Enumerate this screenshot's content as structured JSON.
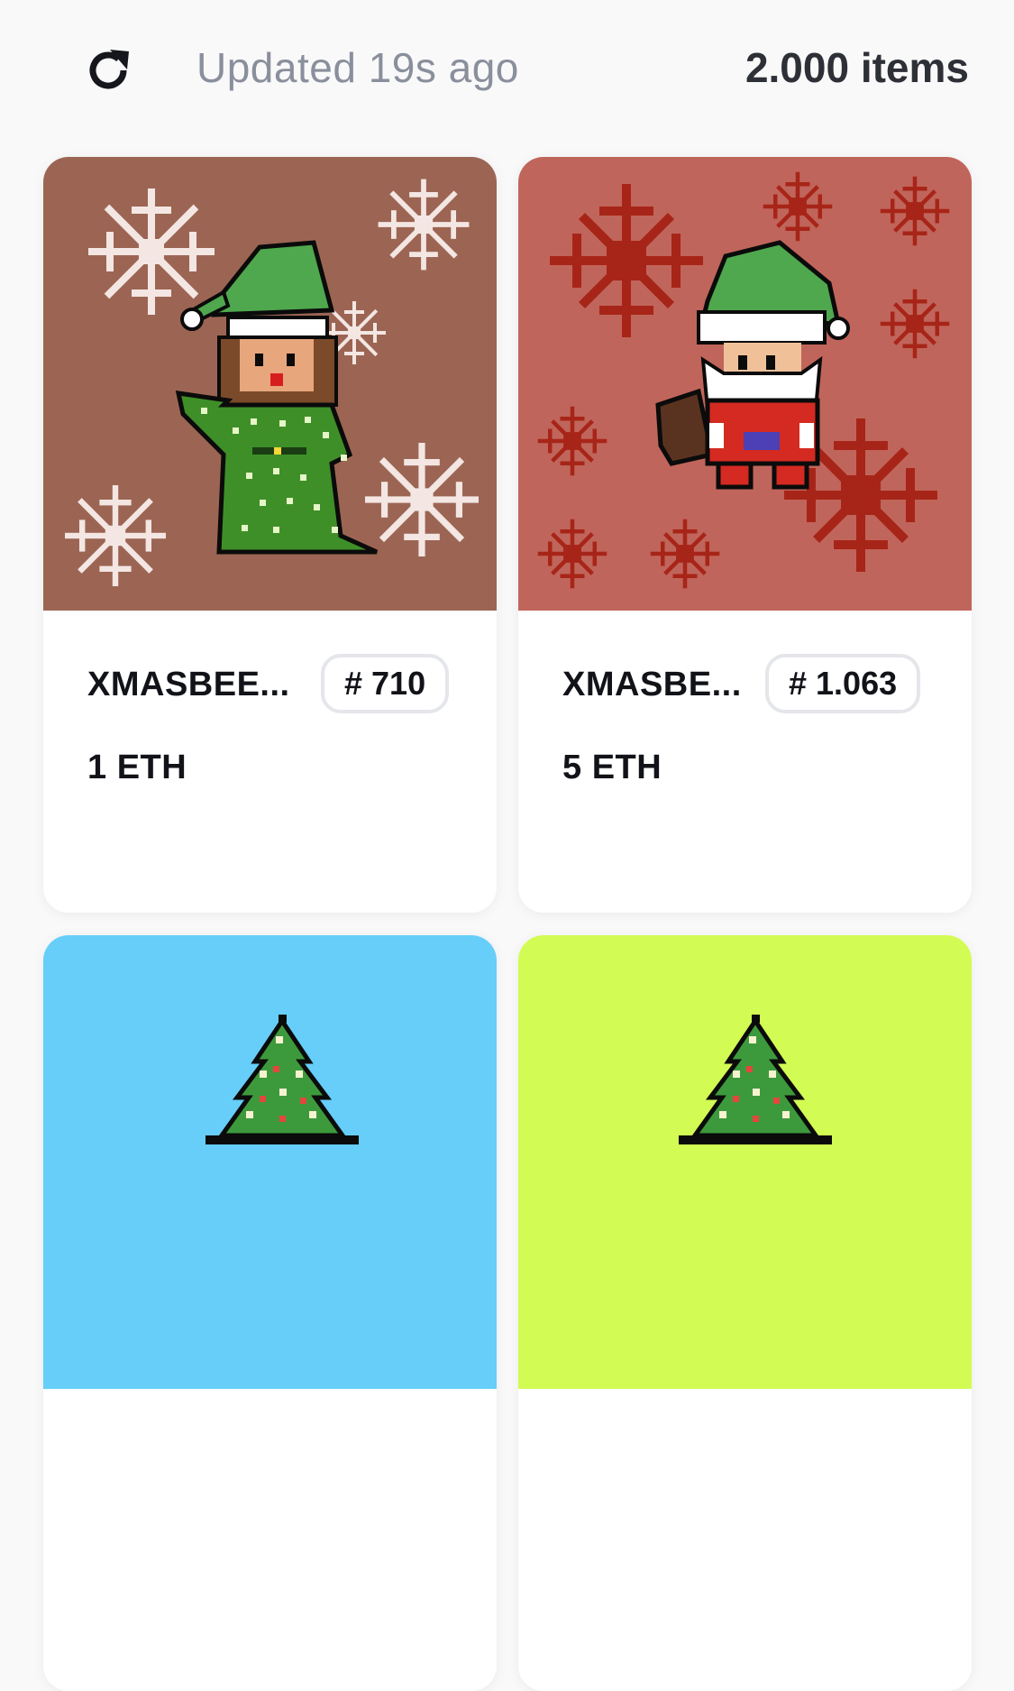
{
  "header": {
    "refresh_icon": "refresh-icon",
    "updated_text": "Updated 19s ago",
    "items_count": "2.000 items"
  },
  "cards": [
    {
      "name": "XMASBEE...",
      "token": "# 710",
      "price": "1 ETH",
      "bg_color": "#9c6553",
      "art": "elf-girl-green-hat-snowflakes"
    },
    {
      "name": "XMASBE...",
      "token": "# 1.063",
      "price": "5 ETH",
      "bg_color": "#c0655b",
      "art": "santa-green-hat-red-snowflakes"
    },
    {
      "bg_color": "#66cef8",
      "art": "christmas-tree"
    },
    {
      "bg_color": "#d2fb54",
      "art": "christmas-tree"
    }
  ],
  "colors": {
    "text_primary": "#111318",
    "text_muted": "#8a8f9c",
    "tag_border": "#e4e6ea"
  }
}
